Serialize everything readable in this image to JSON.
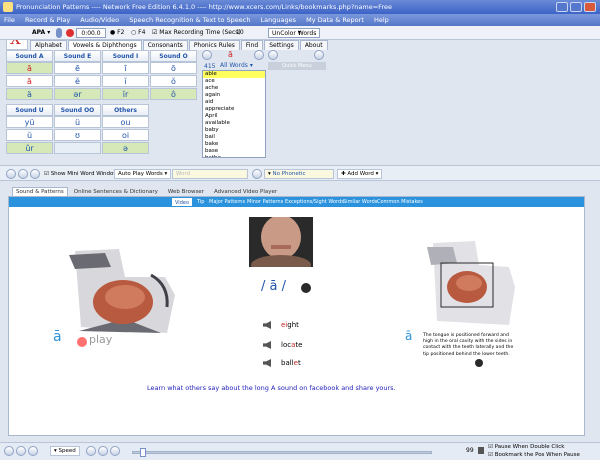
{
  "window": {
    "title": "Pronunciation Patterns ---- Network Free Edition 6.4.1.0 ---- http://www.xcers.com/Links/bookmarks.php?name=Free"
  },
  "menu": [
    "File",
    "Record & Play",
    "Audio/Video",
    "Speech Recognition & Text to Speech",
    "Languages",
    "My Data & Report",
    "Help"
  ],
  "toolbar": {
    "alphabet_select": "APA",
    "timer": "0:00.0",
    "f2": "F2",
    "f4": "F4",
    "max_recording_label": "Max Recording Time (Secs)",
    "max_recording_value": "10",
    "uncolor_button": "UnColor Words"
  },
  "top_tabs": [
    "Alphabet",
    "Vowels & Diphthongs",
    "Consonants",
    "Phonics Rules",
    "Find",
    "Settings",
    "About"
  ],
  "sound_grid": {
    "headers_row1": [
      "Sound A",
      "Sound E",
      "Sound I",
      "Sound O"
    ],
    "rows1": [
      [
        "ā",
        "ē",
        "ī",
        "ō"
      ],
      [
        "ă",
        "ĕ",
        "ĭ",
        "ŏ"
      ],
      [
        "ä",
        "ər",
        "ĭr",
        "ô"
      ]
    ],
    "headers_row2": [
      "Sound U",
      "Sound OO",
      "Others"
    ],
    "rows2": [
      [
        "yü",
        "ü",
        "ou"
      ],
      [
        "ŭ",
        "ʊ",
        "oi"
      ],
      [
        "ûr",
        "",
        "ə"
      ]
    ]
  },
  "word_panel": {
    "count": "415",
    "selector": "All Words",
    "symbol": "ā",
    "words": [
      "able",
      "ace",
      "ache",
      "again",
      "aid",
      "appreciate",
      "April",
      "available",
      "baby",
      "bail",
      "bake",
      "base",
      "bathe"
    ]
  },
  "quick_menu": "Quick Menu",
  "bar2": {
    "show_mini": "Show Mini Word Window",
    "auto_play": "Auto Play Words",
    "word_label": "Word",
    "no_phonetic": "No Phonetic",
    "add_word": "Add Word"
  },
  "content_tabs": [
    "Sound & Patterns",
    "Online Sentences & Dictionary",
    "Web Browser",
    "Advanced Video Player"
  ],
  "sub_tabs": [
    "Video",
    "Tip",
    "Major Patterns",
    "Minor Patterns",
    "Exceptions/Sight Words",
    "Similar Words",
    "Common Mistakes"
  ],
  "main": {
    "symbol_left": "ā",
    "play_label": "play",
    "phonetic": "/ ā /",
    "examples": [
      {
        "red": "ei",
        "rest": "ght"
      },
      {
        "pre": "loc",
        "red": "a",
        "rest": "te"
      },
      {
        "pre": "ball",
        "red": "e",
        "rest": "t"
      }
    ],
    "symbol_right": "ā",
    "description": "The tongue is positioned forward and high in the oral cavity with the sides in contact with the teeth laterally and the tip positioned behind the lower teeth.",
    "facebook_line": "Learn what others say about the long A sound on facebook and share yours."
  },
  "statusbar": {
    "speed": "Speed",
    "volume": "99",
    "pause_check": "Pause When Double Click",
    "bookmark_check": "Bookmark the Pos When Pause"
  },
  "colors": {
    "accent": "#2b93dd",
    "title": "#3c63c8",
    "example_red": "#cc2222",
    "fb_blue": "#2222bb"
  }
}
